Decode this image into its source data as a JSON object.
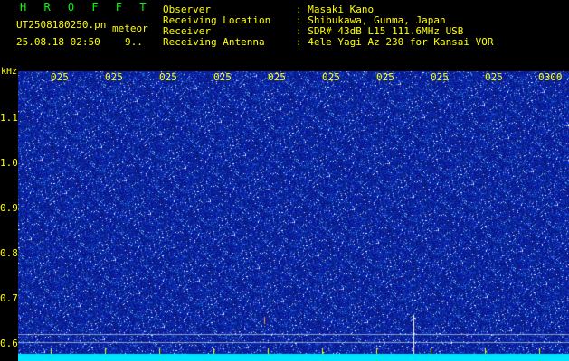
{
  "header": {
    "title": "H R O F F T",
    "filename": "UT2508180250.pn",
    "type_label": "meteor",
    "date_time": "25.08.18 02:50",
    "count": "9.."
  },
  "meta": {
    "observer_label": "Observer",
    "observer_value": ": Masaki Kano",
    "location_label": "Receiving Location",
    "location_value": ": Shibukawa, Gunma, Japan",
    "receiver_label": "Receiver",
    "receiver_value": ": SDR# 43dB L15 111.6MHz USB",
    "antenna_label": "Receiving Antenna",
    "antenna_value": ": 4ele Yagi Az 230 for Kansai VOR"
  },
  "axis": {
    "y_unit": "kHz",
    "y_ticks": [
      "1.1",
      "1.0",
      "0.9",
      "0.8",
      "0.7",
      "0.6"
    ],
    "x_ticks": [
      "025",
      "025",
      "025",
      "025",
      "025",
      "025",
      "025",
      "025",
      "025",
      "0300"
    ]
  },
  "colors": {
    "background": "#000000",
    "waterfall_base": "#0a1a9c",
    "noise_bright": "#d8e8ff",
    "floor_band": "#00e5ff",
    "marker": "#ffff00",
    "title": "#00ff00"
  }
}
